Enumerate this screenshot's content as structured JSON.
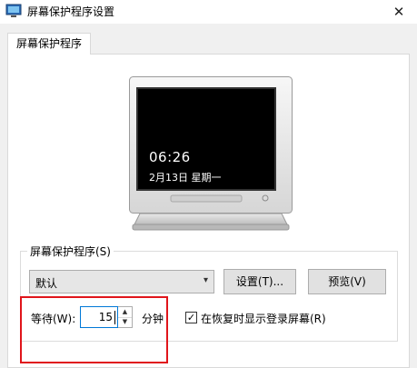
{
  "window": {
    "title": "屏幕保护程序设置",
    "close_glyph": "✕"
  },
  "tabs": [
    {
      "label": "屏幕保护程序"
    }
  ],
  "preview": {
    "time": "06:26",
    "date": "2月13日  星期一"
  },
  "screensaver": {
    "group_label": "屏幕保护程序(S)",
    "selected": "默认",
    "dropdown_arrow": "▾",
    "settings_label": "设置(T)...",
    "preview_label": "预览(V)"
  },
  "wait": {
    "label": "等待(W):",
    "value": "15",
    "up_glyph": "▲",
    "down_glyph": "▼",
    "unit_label": "分钟"
  },
  "resume": {
    "checked": true,
    "check_glyph": "✓",
    "label": "在恢复时显示登录屏幕(R)"
  },
  "colors": {
    "highlight": "#e0151b",
    "focus_border": "#0078d7"
  }
}
